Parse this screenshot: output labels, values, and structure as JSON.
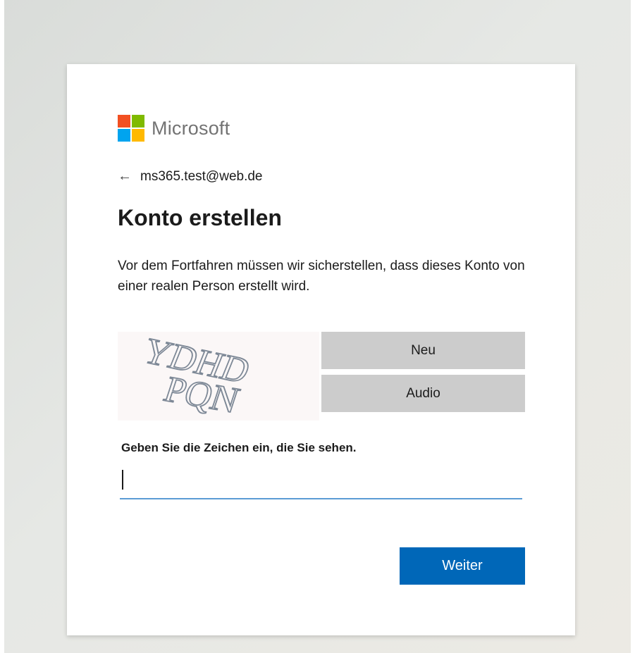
{
  "brand": {
    "name": "Microsoft",
    "logo_colors": [
      "#f25022",
      "#7fba00",
      "#00a4ef",
      "#ffb900"
    ]
  },
  "identity": {
    "back_icon": "arrow-left-icon",
    "email": "ms365.test@web.de"
  },
  "page": {
    "title": "Konto erstellen",
    "description": "Vor dem Fortfahren müssen wir sicherstellen, dass dieses Konto von einer realen Person erstellt wird."
  },
  "captcha": {
    "image_text": [
      "YDHD",
      "PQN"
    ],
    "new_label": "Neu",
    "audio_label": "Audio"
  },
  "input": {
    "label": "Geben Sie die Zeichen ein, die Sie sehen.",
    "value": "",
    "placeholder": ""
  },
  "actions": {
    "next_label": "Weiter"
  },
  "colors": {
    "accent": "#0067b8",
    "input_underline": "#5b9bd5",
    "secondary_button": "#cccccc"
  }
}
